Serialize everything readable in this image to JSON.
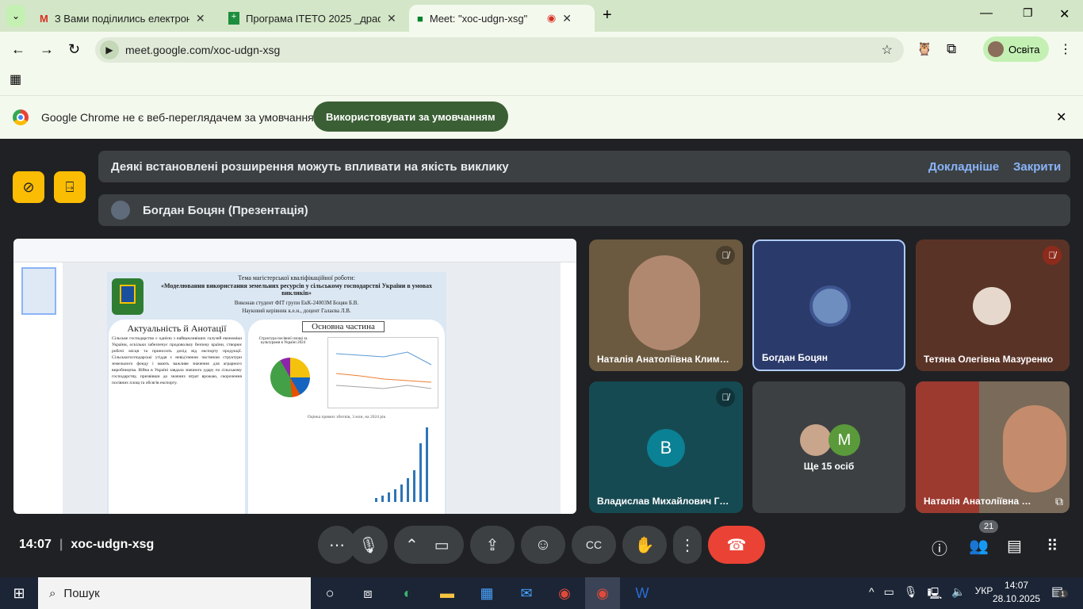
{
  "browser": {
    "tabs": [
      {
        "title": "З Вами поділились електронною",
        "icon": "gmail-icon"
      },
      {
        "title": "Програма ITETO 2025 _драфт -",
        "icon": "sheets-icon"
      },
      {
        "title": "Meet: \"xoc-udgn-xsg\"",
        "icon": "meet-icon",
        "active": true
      }
    ],
    "url": "meet.google.com/xoc-udgn-xsg",
    "profile": "Освіта",
    "infobar": {
      "text": "Google Chrome не є веб-переглядачем за умовчанням",
      "button": "Використовувати за умовчанням"
    }
  },
  "meet": {
    "banner": {
      "text": "Деякі встановлені розширення можуть впливати на якість виклику",
      "learn_more": "Докладніше",
      "close": "Закрити"
    },
    "presenter": "Богдан Боцян (Презентація)",
    "slide": {
      "theme": "Тема магістерської кваліфікаційної роботи:",
      "title": "«Моделювання використання земельних ресурсів у сільському господарстві України в умовах викликів»",
      "author": "Виконав студент ФІТ групи ЕкК-24003М Боцян Б.В.",
      "supervisor": "Науковий керівник к.е.н., доцент Галаєва Л.В.",
      "left_heading": "Актуальність й Анотації",
      "right_heading": "Основна частина",
      "left_text": "Сільське господарство є однією з найважливіших галузей економіки України, оскільки забезпечує продовольчу безпеку країни, створює робочі місця та приносить дохід від експорту продукції. Сільськогосподарські угіддя є невід'ємною частиною структури земельного фонду і мають важливе значення для аграрного виробництва. Війна в Україні завдала значного удару по сільському господарству, призвівши до значних втрат врожаю, скорочення посівних площ та обсягів експорту.",
      "pie_title": "Структура посівної площі за культурами в Україні 2024",
      "bar_title": "Оцінка прямих збитків, 3 млн, на 2024 рік"
    },
    "participants": [
      {
        "name": "Наталія Анатоліївна Клим…",
        "muted": true
      },
      {
        "name": "Богдан Боцян",
        "muted": false
      },
      {
        "name": "Тетяна Олегівна Мазуренко",
        "muted": true
      },
      {
        "name": "Владислав Михайлович Г…",
        "muted": true,
        "initial": "B"
      },
      {
        "name": "Ще 15 осіб",
        "initial": "M"
      },
      {
        "name": "Наталія Анатоліївна …"
      }
    ],
    "time": "14:07",
    "meeting_code": "xoc-udgn-xsg",
    "people_count": "21"
  },
  "taskbar": {
    "search": "Пошук",
    "lang": "УКР",
    "time": "14:07",
    "date": "28.10.2025",
    "notifications": "1"
  }
}
